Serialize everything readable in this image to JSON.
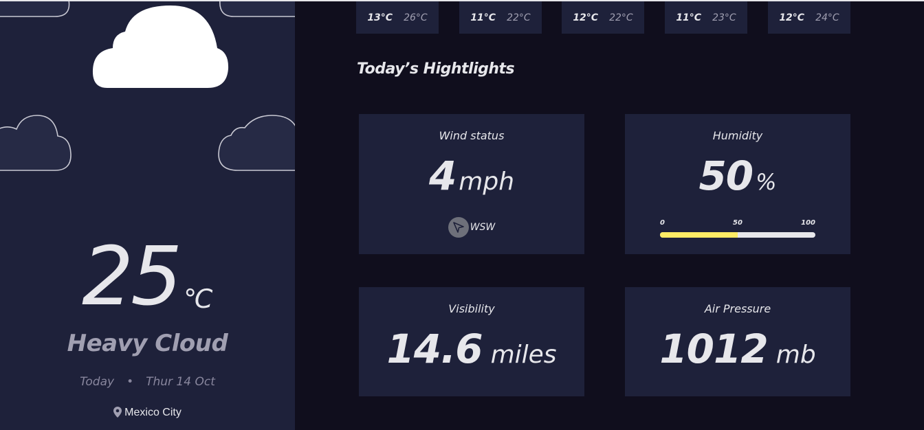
{
  "sidebar": {
    "temperature": "25",
    "temperature_unit": "℃",
    "condition": "Heavy Cloud",
    "date_label": "Today",
    "separator": "•",
    "date": "Thur 14 Oct",
    "location": "Mexico City",
    "icons": {
      "weather": "cloud-icon",
      "location": "map-pin-icon"
    }
  },
  "forecast": [
    {
      "max": "13°C",
      "min": "26°C"
    },
    {
      "max": "11°C",
      "min": "22°C"
    },
    {
      "max": "12°C",
      "min": "22°C"
    },
    {
      "max": "11°C",
      "min": "23°C"
    },
    {
      "max": "12°C",
      "min": "24°C"
    }
  ],
  "highlights": {
    "title": "Today’s Hightlights",
    "wind": {
      "label": "Wind status",
      "value": "4",
      "unit": "mph",
      "direction": "WSW",
      "icon": "navigation-arrow-icon"
    },
    "humidity": {
      "label": "Humidity",
      "value": "50",
      "unit": "%",
      "scale": [
        "0",
        "50",
        "100"
      ],
      "level_percent": 50
    },
    "visibility": {
      "label": "Visibility",
      "value": "14.6",
      "unit": "miles"
    },
    "pressure": {
      "label": "Air Pressure",
      "value": "1012",
      "unit": "mb"
    }
  },
  "colors": {
    "sidebar_bg": "#1e213a",
    "main_bg": "#100e1d",
    "text": "#e7e7eb",
    "muted": "#a09fb1",
    "humidity_bar": "#ffec65"
  }
}
